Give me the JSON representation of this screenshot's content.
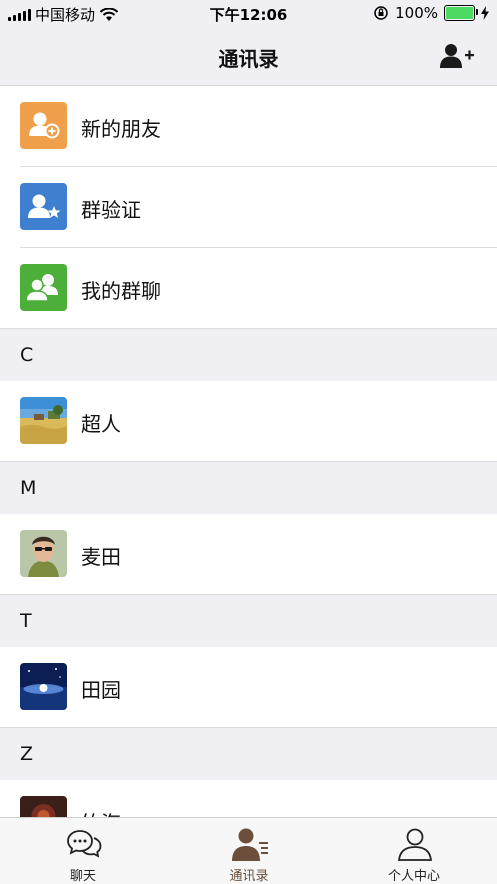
{
  "status_bar": {
    "carrier": "中国移动",
    "time": "下午12:06",
    "battery_percent": "100%",
    "battery_level": 1.0,
    "battery_color": "#4cd964"
  },
  "nav": {
    "title": "通讯录",
    "add_icon": "add-contact-icon"
  },
  "quick_items": [
    {
      "label": "新的朋友",
      "icon": "new-friend-icon",
      "color": "#f0a04b"
    },
    {
      "label": "群验证",
      "icon": "group-verify-icon",
      "color": "#3f7fd0"
    },
    {
      "label": "我的群聊",
      "icon": "group-chat-icon",
      "color": "#4caf3a"
    }
  ],
  "sections": [
    {
      "letter": "C",
      "contacts": [
        {
          "name": "超人",
          "avatar": "field-photo"
        }
      ]
    },
    {
      "letter": "M",
      "contacts": [
        {
          "name": "麦田",
          "avatar": "portrait-photo"
        }
      ]
    },
    {
      "letter": "T",
      "contacts": [
        {
          "name": "田园",
          "avatar": "night-sky-photo"
        }
      ]
    },
    {
      "letter": "Z",
      "contacts": [
        {
          "name": "竹海",
          "avatar": "dark-photo"
        }
      ]
    }
  ],
  "tabs": [
    {
      "label": "聊天",
      "icon": "chat-icon",
      "active": false
    },
    {
      "label": "通讯录",
      "icon": "contacts-icon",
      "active": true
    },
    {
      "label": "个人中心",
      "icon": "profile-icon",
      "active": false
    }
  ],
  "colors": {
    "accent_active": "#6b4f3b",
    "bar_background": "#efeff4"
  }
}
